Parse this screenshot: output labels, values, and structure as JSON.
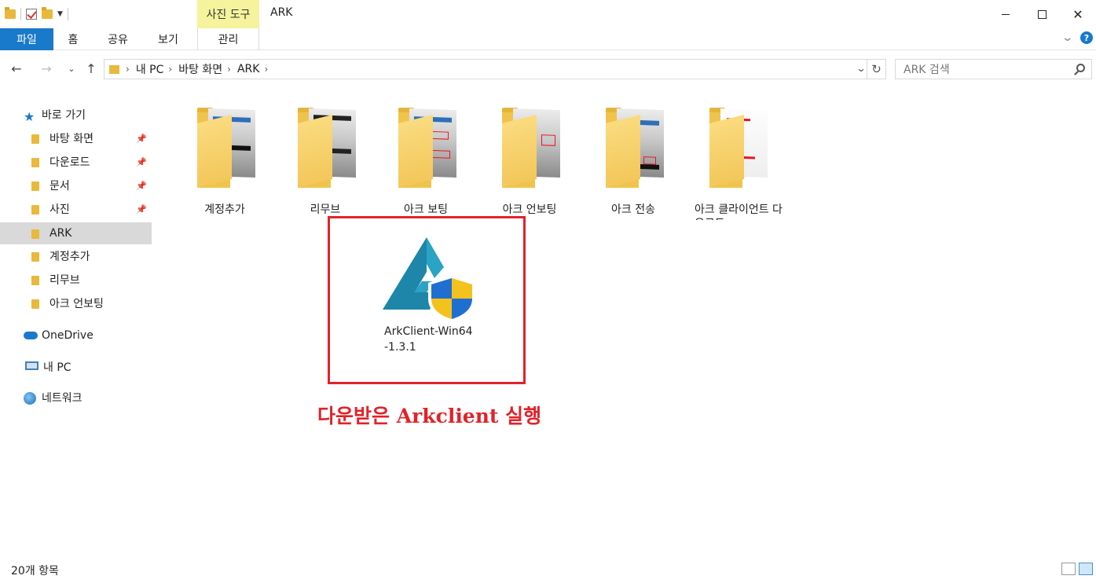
{
  "window": {
    "title": "ARK",
    "tools_tab": "사진 도구"
  },
  "ribbon": {
    "tabs": [
      "파일",
      "홈",
      "공유",
      "보기",
      "관리"
    ]
  },
  "address": {
    "crumbs": [
      "내 PC",
      "바탕 화면",
      "ARK"
    ],
    "search_placeholder": "ARK 검색"
  },
  "sidebar": {
    "quick_access": "바로 가기",
    "items": [
      {
        "label": "바탕 화면",
        "pinned": true
      },
      {
        "label": "다운로드",
        "pinned": true
      },
      {
        "label": "문서",
        "pinned": true
      },
      {
        "label": "사진",
        "pinned": true
      },
      {
        "label": "ARK",
        "pinned": false,
        "selected": true
      },
      {
        "label": "계정추가",
        "pinned": false
      },
      {
        "label": "리무브",
        "pinned": false
      },
      {
        "label": "아크 언보팅",
        "pinned": false
      }
    ],
    "onedrive": "OneDrive",
    "this_pc": "내 PC",
    "network": "네트워크"
  },
  "content": {
    "folders": [
      "계정추가",
      "리무브",
      "아크 보팅",
      "아크 언보팅",
      "아크 전송",
      "아크 클라이언트 다운로드"
    ],
    "app_file": {
      "line1": "ArkClient-Win64",
      "line2": "-1.3.1"
    },
    "annotation": "다운받은 Arkclient 실행"
  },
  "status": {
    "item_count": "20개 항목"
  },
  "colors": {
    "accent": "#1979ca",
    "tools_tab": "#f5f39b",
    "annotation": "#e2222a",
    "folder": "#f0c44c"
  }
}
